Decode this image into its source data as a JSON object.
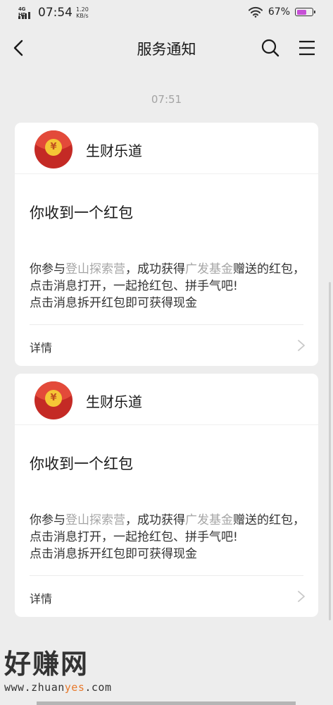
{
  "status_bar": {
    "network": "4G HD",
    "time": "07:54",
    "speed_value": "1.20",
    "speed_unit": "KB/s",
    "battery_percent": "67%",
    "battery_level": 0.67,
    "battery_color": "#c64fd6"
  },
  "nav": {
    "back_icon": "chevron-left-icon",
    "title": "服务通知",
    "search_icon": "search-icon",
    "menu_icon": "hamburger-menu-icon"
  },
  "message_time": "07:51",
  "cards": [
    {
      "avatar_icon": "red-envelope-yuan-icon",
      "coin_symbol": "¥",
      "brand": "生财乐道",
      "title": "你收到一个红包",
      "desc_prefix": "你参与",
      "desc_link1": "登山探索营",
      "desc_middle": "，成功获得",
      "desc_link2": "广发基金",
      "desc_suffix": "赠送的红包，点击消息打开，一起抢红包、拼手气吧!",
      "desc_line2": "点击消息拆开红包即可获得现金",
      "details_label": "详情"
    },
    {
      "avatar_icon": "red-envelope-yuan-icon",
      "coin_symbol": "¥",
      "brand": "生财乐道",
      "title": "你收到一个红包",
      "desc_prefix": "你参与",
      "desc_link1": "登山探索营",
      "desc_middle": "，成功获得",
      "desc_link2": "广发基金",
      "desc_suffix": "赠送的红包，点击消息打开，一起抢红包、拼手气吧!",
      "desc_line2": "点击消息拆开红包即可获得现金",
      "details_label": "详情"
    }
  ],
  "watermark": {
    "main": "好赚网",
    "url_part1": "www.zhuan",
    "url_accent": "yes",
    "url_part2": ".com"
  },
  "colors": {
    "background": "#ededed",
    "card": "#ffffff",
    "link_text": "#a6a6a6",
    "avatar_red": "#c42a25",
    "coin_gold": "#f5c636"
  }
}
